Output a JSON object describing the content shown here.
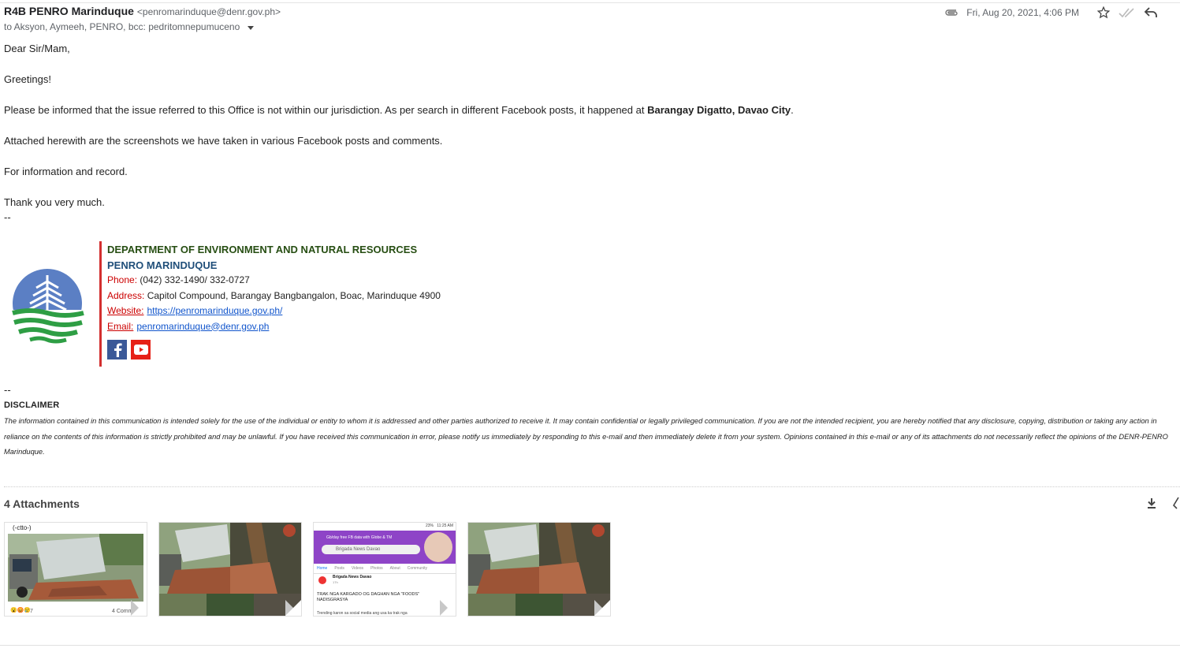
{
  "header": {
    "sender_name": "R4B PENRO Marinduque",
    "sender_email": "<penromarinduque@denr.gov.ph>",
    "recipients": "to Aksyon, Aymeeh, PENRO, bcc: pedritomnepumuceno",
    "date": "Fri, Aug 20, 2021, 4:06 PM",
    "icons": [
      "paperclip-icon",
      "star-icon",
      "double-check-icon",
      "reply-icon",
      "chevron-down-icon"
    ]
  },
  "body": {
    "salutation": "Dear Sir/Mam,",
    "greeting": "Greetings!",
    "para1_prefix": "Please be informed that the issue referred to this Office is not within our jurisdiction. As per search in different Facebook posts, it happened at ",
    "para1_bold": "Barangay Digatto, Davao City",
    "para1_suffix": ".",
    "para2": "Attached herewith are the screenshots we have taken in various Facebook posts and comments.",
    "para3": "For information and record.",
    "para4": "Thank you very much.",
    "sig_dash": "--"
  },
  "signature": {
    "dept": "DEPARTMENT OF ENVIRONMENT AND NATURAL RESOURCES",
    "office": "PENRO MARINDUQUE",
    "phone_label": "Phone:",
    "phone": " (042) 332-1490/ 332-0727",
    "address_label": "Address:",
    "address": " Capitol Compound, Barangay Bangbangalon, Boac, Marinduque 4900",
    "website_label": "Website:",
    "website": "https://penromarinduque.gov.ph/",
    "email_label": "Email:",
    "email": "penromarinduque@denr.gov.ph",
    "logo_colors": {
      "blue": "#5b7fc4",
      "green": "#2e9e44"
    },
    "social": [
      "facebook-icon",
      "youtube-icon"
    ],
    "accent": "#d32f2f"
  },
  "disclaimer": {
    "dash": "--",
    "title": "DISCLAIMER",
    "text": "The information contained in this communication is intended solely for the use of the individual or entity to whom it is addressed and other parties authorized to receive it. It may contain confidential or legally privileged communication. If you are not the intended recipient, you are hereby notified that any disclosure, copying, distribution or taking any action in reliance on the contents of this information is strictly prohibited and may be unlawful. If you have received this communication in error, please notify us immediately by responding to this e-mail and then immediately delete it from your system. Opinions contained in this e-mail or any of its attachments do not necessarily reflect the opinions of the DENR-PENRO Marinduque."
  },
  "attachments": {
    "title": "4 Attachments",
    "actions": [
      "download-icon",
      "add-to-drive-icon"
    ],
    "items": [
      {
        "caption_top": "(-ctto-)",
        "caption_bottom_left": "7",
        "caption_bottom_right": "4 Comm"
      },
      {
        "caption_top": ""
      },
      {
        "status_time": "11:25 AM",
        "status_battery": "23%",
        "banner": "Gb/day free FB data with Globe & TM",
        "search": "Brigada News Davao",
        "tabs": [
          "Home",
          "Posts",
          "Videos",
          "Photos",
          "About",
          "Community"
        ],
        "post_author": "Brigada News Davao",
        "post_time": "17h",
        "post_text": "TRAK NGA KARGADO OG DAGHAN NGA \"FOODS\" NADISGRASYA",
        "post_more": "Trending karon sa social media ang usa ka trak nga"
      },
      {
        "caption_top": ""
      }
    ]
  }
}
